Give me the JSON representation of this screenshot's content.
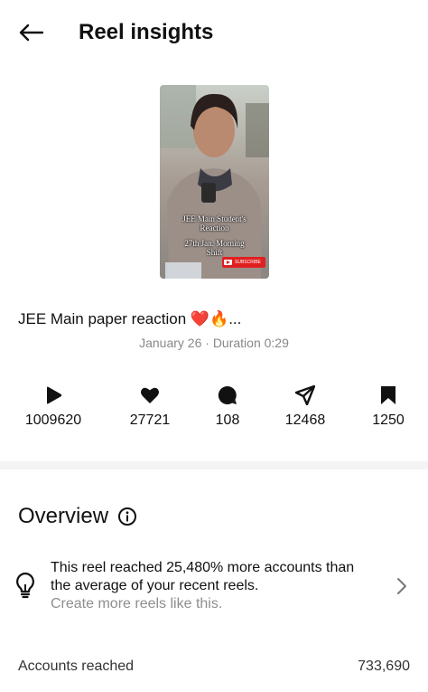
{
  "header": {
    "title": "Reel insights",
    "back_icon": "arrow-left-icon"
  },
  "thumbnail": {
    "caption_lines": [
      "JEE Main Student's",
      "Reaction",
      "27th Jan. Morning",
      "Shift"
    ],
    "subscribe_label": "SUBSCRIBE"
  },
  "reel": {
    "title": "JEE Main paper reaction ❤️🔥...",
    "meta": "January 26 · Duration 0:29"
  },
  "stats": [
    {
      "icon": "play-icon",
      "value": "1009620"
    },
    {
      "icon": "heart-icon",
      "value": "27721"
    },
    {
      "icon": "comment-icon",
      "value": "108"
    },
    {
      "icon": "share-icon",
      "value": "12468"
    },
    {
      "icon": "bookmark-icon",
      "value": "1250"
    }
  ],
  "overview": {
    "heading": "Overview",
    "insight_text": "This reel reached 25,480% more accounts than the average of your recent reels.",
    "insight_link": "Create more reels like this."
  },
  "accounts_reached": {
    "label": "Accounts reached",
    "value": "733,690"
  },
  "colors": {
    "text": "#111111",
    "muted": "#8e8e8e",
    "subscribe": "#e02020",
    "divider": "#f4f4f4"
  }
}
